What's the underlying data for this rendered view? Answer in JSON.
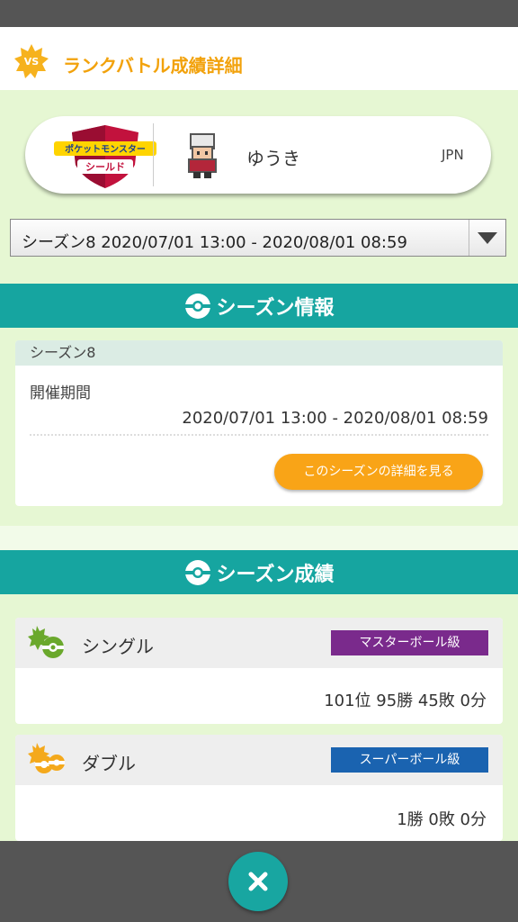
{
  "header": {
    "badge": "VS",
    "title": "ランクバトル成績詳細"
  },
  "trainer": {
    "game_logo_text": "ポケットモンスター シールド",
    "name": "ゆうき",
    "region": "JPN"
  },
  "season_select": {
    "selected": "シーズン8 2020/07/01 13:00 - 2020/08/01 08:59"
  },
  "season_info": {
    "section_title": "シーズン情報",
    "season_name": "シーズン8",
    "period_label": "開催期間",
    "period_value": "2020/07/01 13:00 - 2020/08/01 08:59",
    "detail_button": "このシーズンの詳細を見る"
  },
  "season_record": {
    "section_title": "シーズン成績",
    "single": {
      "label": "シングル",
      "rank": "マスターボール級",
      "result": "101位 95勝 45敗 0分",
      "rank_color": "#7a2a8c"
    },
    "double": {
      "label": "ダブル",
      "rank": "スーパーボール級",
      "result": "1勝 0敗 0分",
      "rank_color": "#1a63b0"
    }
  },
  "colors": {
    "accent": "#f2a20c",
    "teal": "#16a5a0",
    "button": "#f9a417"
  },
  "icons": {
    "close": "close-icon",
    "section": "pokeball-icon"
  }
}
